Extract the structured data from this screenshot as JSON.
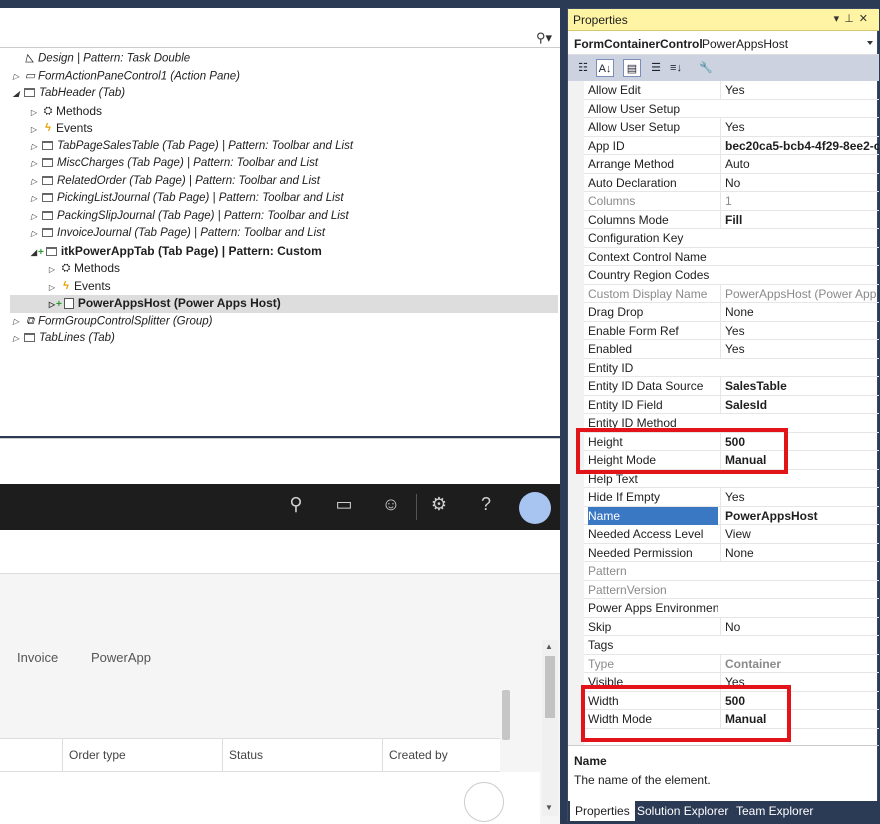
{
  "tree": {
    "nodes": [
      {
        "label": "Design | Pattern: Task Double",
        "style": "italic",
        "indent": 0,
        "arrow": "",
        "icon": "design"
      },
      {
        "label": "FormActionPaneControl1 (Action Pane)",
        "style": "italic",
        "indent": 0,
        "arrow": "closed",
        "icon": "pane"
      },
      {
        "label": "TabHeader (Tab)",
        "style": "italic",
        "indent": 0,
        "arrow": "open",
        "icon": "folder"
      },
      {
        "label": "Methods",
        "style": "",
        "indent": 1,
        "arrow": "closed",
        "icon": "methods"
      },
      {
        "label": "Events",
        "style": "",
        "indent": 1,
        "arrow": "closed",
        "icon": "events"
      },
      {
        "label": "TabPageSalesTable (Tab Page) | Pattern: Toolbar and List",
        "style": "italic",
        "indent": 1,
        "arrow": "closed",
        "icon": "folder"
      },
      {
        "label": "MiscCharges (Tab Page) | Pattern: Toolbar and List",
        "style": "italic",
        "indent": 1,
        "arrow": "closed",
        "icon": "folder"
      },
      {
        "label": "RelatedOrder (Tab Page) | Pattern: Toolbar and List",
        "style": "italic",
        "indent": 1,
        "arrow": "closed",
        "icon": "folder"
      },
      {
        "label": "PickingListJournal (Tab Page) | Pattern: Toolbar and List",
        "style": "italic",
        "indent": 1,
        "arrow": "closed",
        "icon": "folder"
      },
      {
        "label": "PackingSlipJournal (Tab Page) | Pattern: Toolbar and List",
        "style": "italic",
        "indent": 1,
        "arrow": "closed",
        "icon": "folder"
      },
      {
        "label": "InvoiceJournal (Tab Page) | Pattern: Toolbar and List",
        "style": "italic",
        "indent": 1,
        "arrow": "closed",
        "icon": "folder"
      },
      {
        "label": "itkPowerAppTab (Tab Page) | Pattern: Custom",
        "style": "bold",
        "indent": 1,
        "arrow": "open",
        "icon": "folder-new"
      },
      {
        "label": "Methods",
        "style": "",
        "indent": 2,
        "arrow": "closed",
        "icon": "methods"
      },
      {
        "label": "Events",
        "style": "",
        "indent": 2,
        "arrow": "closed",
        "icon": "events"
      },
      {
        "label": "PowerAppsHost (Power Apps Host)",
        "style": "bold sel",
        "indent": 2,
        "arrow": "closed",
        "icon": "page-new"
      },
      {
        "label": "FormGroupControlSplitter (Group)",
        "style": "italic",
        "indent": 0,
        "arrow": "closed",
        "icon": "group"
      },
      {
        "label": "TabLines (Tab)",
        "style": "italic",
        "indent": 0,
        "arrow": "closed",
        "icon": "folder"
      }
    ]
  },
  "preview": {
    "tabs": [
      "Invoice",
      "PowerApp"
    ],
    "columns": [
      "Order type",
      "Status",
      "Created by"
    ]
  },
  "properties": {
    "title": "Properties",
    "object_name": "FormContainerControl",
    "object_type": "PowerAppsHost",
    "rows": [
      {
        "name": "Allow Edit",
        "value": "Yes",
        "state": ""
      },
      {
        "name": "Allow User Setup",
        "value": "",
        "state": ""
      },
      {
        "name": "Allow User Setup",
        "value": "Yes",
        "state": ""
      },
      {
        "name": "App ID",
        "value": "bec20ca5-bcb4-4f29-8ee2-c",
        "state": "b"
      },
      {
        "name": "Arrange Method",
        "value": "Auto",
        "state": ""
      },
      {
        "name": "Auto Declaration",
        "value": "No",
        "state": ""
      },
      {
        "name": "Columns",
        "value": "1",
        "state": "gray"
      },
      {
        "name": "Columns Mode",
        "value": "Fill",
        "state": "b"
      },
      {
        "name": "Configuration Key",
        "value": "",
        "state": ""
      },
      {
        "name": "Context Control Name",
        "value": "",
        "state": ""
      },
      {
        "name": "Country Region Codes",
        "value": "",
        "state": ""
      },
      {
        "name": "Custom Display Name",
        "value": "PowerAppsHost (Power App",
        "state": "gray"
      },
      {
        "name": "Drag Drop",
        "value": "None",
        "state": ""
      },
      {
        "name": "Enable Form Ref",
        "value": "Yes",
        "state": ""
      },
      {
        "name": "Enabled",
        "value": "Yes",
        "state": ""
      },
      {
        "name": "Entity ID",
        "value": "",
        "state": ""
      },
      {
        "name": "Entity ID Data Source",
        "value": "SalesTable",
        "state": "b"
      },
      {
        "name": "Entity ID Field",
        "value": "SalesId",
        "state": "b"
      },
      {
        "name": "Entity ID Method",
        "value": "",
        "state": ""
      },
      {
        "name": "Height",
        "value": "500",
        "state": "b"
      },
      {
        "name": "Height Mode",
        "value": "Manual",
        "state": "b"
      },
      {
        "name": "Help Text",
        "value": "",
        "state": ""
      },
      {
        "name": "Hide If Empty",
        "value": "Yes",
        "state": ""
      },
      {
        "name": "Name",
        "value": "PowerAppsHost",
        "state": "b sel"
      },
      {
        "name": "Needed Access Level",
        "value": "View",
        "state": ""
      },
      {
        "name": "Needed Permission",
        "value": "None",
        "state": ""
      },
      {
        "name": "Pattern",
        "value": "",
        "state": "gray"
      },
      {
        "name": "PatternVersion",
        "value": "",
        "state": "gray"
      },
      {
        "name": "Power Apps Environment",
        "value": "",
        "state": ""
      },
      {
        "name": "Skip",
        "value": "No",
        "state": ""
      },
      {
        "name": "Tags",
        "value": "",
        "state": ""
      },
      {
        "name": "Type",
        "value": "Container",
        "state": "gray b"
      },
      {
        "name": "Visible",
        "value": "Yes",
        "state": ""
      },
      {
        "name": "Width",
        "value": "500",
        "state": "b"
      },
      {
        "name": "Width Mode",
        "value": "Manual",
        "state": "b"
      }
    ],
    "description_name": "Name",
    "description_text": "The name of the element.",
    "bottom_tabs": [
      "Properties",
      "Solution Explorer",
      "Team Explorer"
    ]
  },
  "colors": {
    "highlight": "#e2141a",
    "selection": "#3b78c4",
    "title_bar": "#fff4a4"
  }
}
